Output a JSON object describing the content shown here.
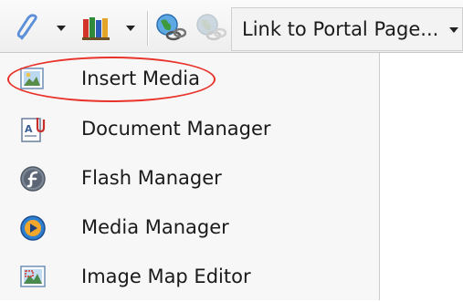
{
  "toolbar": {
    "buttons": [
      {
        "icon": "hyperlink-icon",
        "has_dropdown": true
      },
      {
        "icon": "library-icon",
        "has_dropdown": true
      },
      {
        "icon": "link-globe-icon"
      },
      {
        "icon": "unlink-globe-icon"
      }
    ],
    "portal_link_label": "Link to Portal Page..."
  },
  "menu": {
    "items": [
      {
        "label": "Insert Media",
        "icon": "insert-media-icon"
      },
      {
        "label": "Document Manager",
        "icon": "document-manager-icon"
      },
      {
        "label": "Flash Manager",
        "icon": "flash-manager-icon"
      },
      {
        "label": "Media Manager",
        "icon": "media-manager-icon"
      },
      {
        "label": "Image Map Editor",
        "icon": "image-map-editor-icon"
      }
    ]
  },
  "colors": {
    "highlight": "#e8322a",
    "menu_background": "#f7f7f7"
  }
}
